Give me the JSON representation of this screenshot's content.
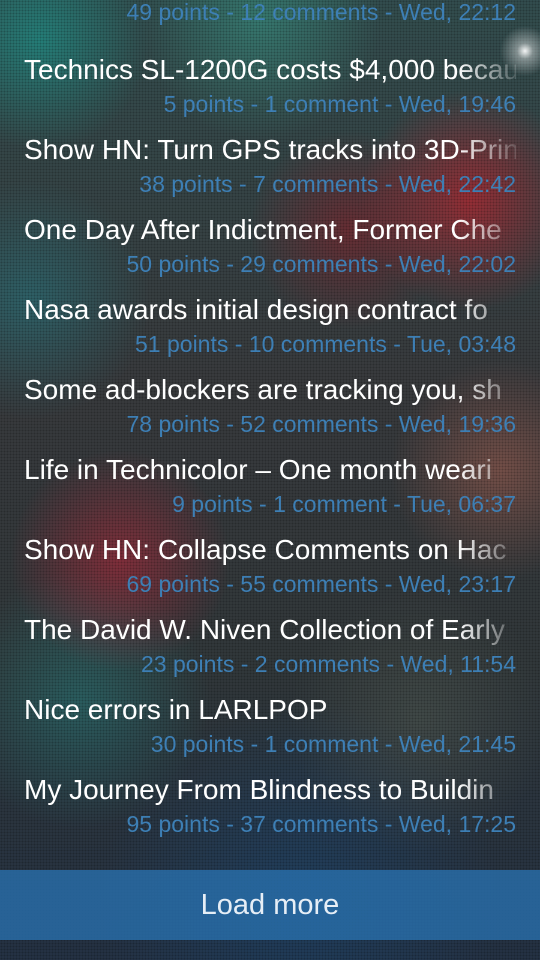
{
  "stories": [
    {
      "title": "",
      "meta": "49 points - 12 comments - Wed, 22:12"
    },
    {
      "title": "Technics SL-1200G costs $4,000 becau",
      "meta": "5 points - 1 comment - Wed, 19:46"
    },
    {
      "title": "Show HN: Turn GPS tracks into 3D-Prin",
      "meta": "38 points - 7 comments - Wed, 22:42"
    },
    {
      "title": "One Day After Indictment, Former Che",
      "meta": "50 points - 29 comments - Wed, 22:02"
    },
    {
      "title": "Nasa awards initial design contract fo",
      "meta": "51 points - 10 comments - Tue, 03:48"
    },
    {
      "title": "Some ad-blockers are tracking you, sh",
      "meta": "78 points - 52 comments - Wed, 19:36"
    },
    {
      "title": "Life in Technicolor – One month weari",
      "meta": "9 points - 1 comment - Tue, 06:37"
    },
    {
      "title": "Show HN: Collapse Comments on Hac",
      "meta": "69 points - 55 comments - Wed, 23:17"
    },
    {
      "title": "The David W. Niven Collection of Early",
      "meta": "23 points - 2 comments - Wed, 11:54"
    },
    {
      "title": "Nice errors in LARLPOP",
      "meta": "30 points - 1 comment - Wed, 21:45"
    },
    {
      "title": "My Journey From Blindness to Buildin",
      "meta": "95 points - 37 comments - Wed, 17:25"
    }
  ],
  "load_more_label": "Load more",
  "colors": {
    "meta_text": "#3d7fb5",
    "title_text": "#ffffff",
    "load_more_bg": "#286eaa"
  }
}
